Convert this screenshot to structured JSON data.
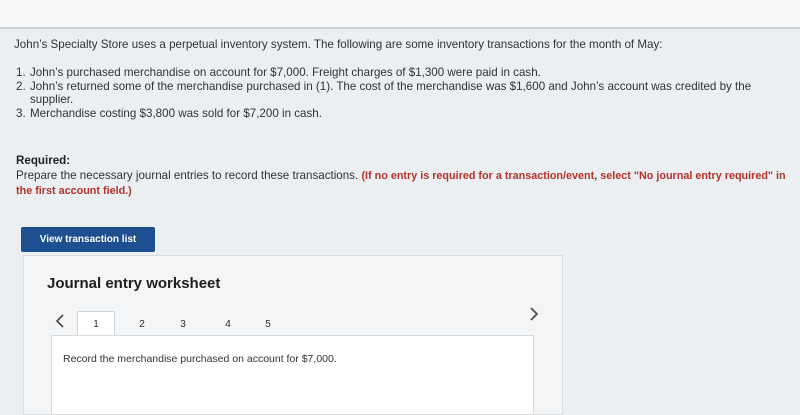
{
  "problem": {
    "intro": "John’s Specialty Store uses a perpetual inventory system. The following are some inventory transactions for the month of May:",
    "transactions": [
      {
        "num": "1.",
        "text": "John’s purchased merchandise on account for $7,000. Freight charges of $1,300 were paid in cash."
      },
      {
        "num": "2.",
        "text": "John’s returned some of the merchandise purchased in (1). The cost of the merchandise was $1,600 and John’s account was credited by the supplier."
      },
      {
        "num": "3.",
        "text": "Merchandise costing $3,800 was sold for $7,200 in cash."
      }
    ]
  },
  "required": {
    "label": "Required:",
    "text": "Prepare the necessary journal entries to record these transactions.",
    "emphasis": "(If no entry is required for a transaction/event, select \"No journal entry required\" in the first account field.)"
  },
  "buttons": {
    "view_transactions": "View transaction list"
  },
  "worksheet": {
    "title": "Journal entry worksheet",
    "tabs": [
      "1",
      "2",
      "3",
      "4",
      "5"
    ],
    "active_tab": "1",
    "instruction": "Record the merchandise purchased on account for $7,000."
  },
  "icons": {
    "prev": "chevron-left-icon",
    "next": "chevron-right-icon"
  },
  "colors": {
    "button": "#1d4f91",
    "emphasis": "#b3322a"
  }
}
